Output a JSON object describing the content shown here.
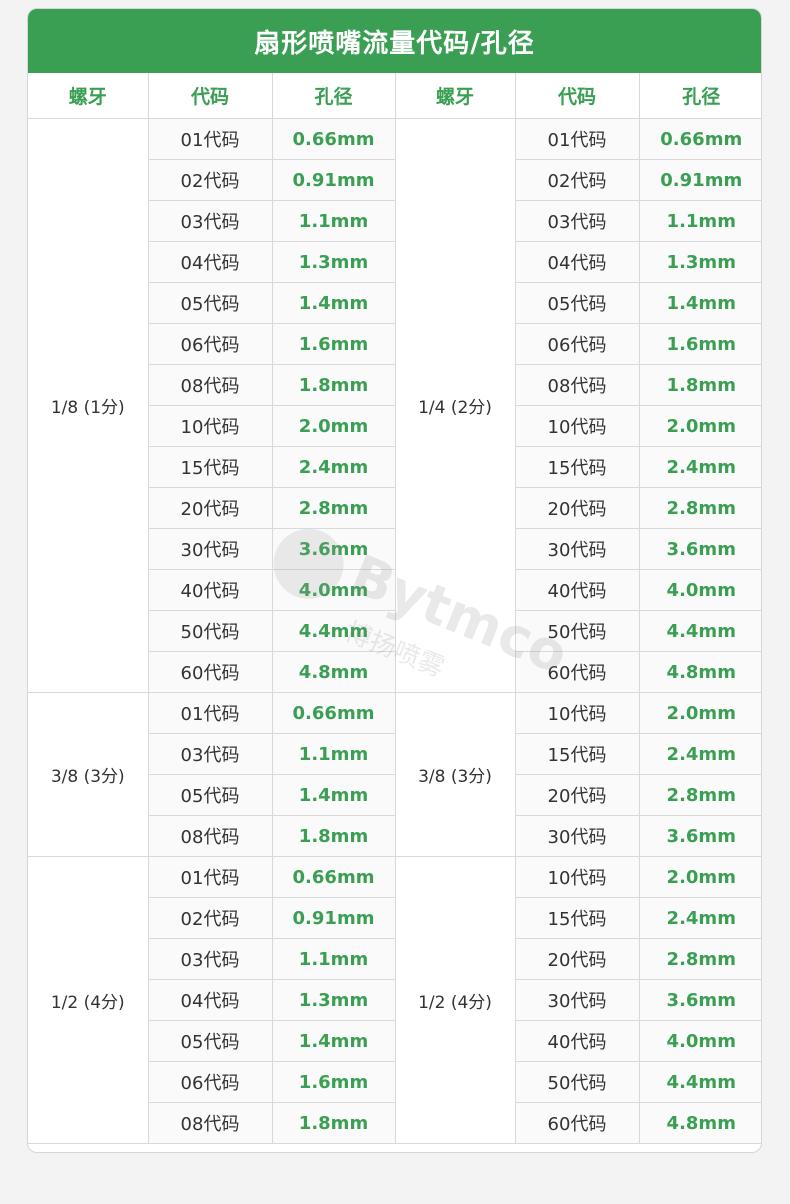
{
  "title": "扇形喷嘴流量代码/孔径",
  "headers": [
    "螺牙",
    "代码",
    "孔径",
    "螺牙",
    "代码",
    "孔径"
  ],
  "left_groups": [
    {
      "thread": "1/8 (1分)",
      "rows": [
        {
          "code": "01代码",
          "dia": "0.66mm"
        },
        {
          "code": "02代码",
          "dia": "0.91mm"
        },
        {
          "code": "03代码",
          "dia": "1.1mm"
        },
        {
          "code": "04代码",
          "dia": "1.3mm"
        },
        {
          "code": "05代码",
          "dia": "1.4mm"
        },
        {
          "code": "06代码",
          "dia": "1.6mm"
        },
        {
          "code": "08代码",
          "dia": "1.8mm"
        },
        {
          "code": "10代码",
          "dia": "2.0mm"
        },
        {
          "code": "15代码",
          "dia": "2.4mm"
        },
        {
          "code": "20代码",
          "dia": "2.8mm"
        },
        {
          "code": "30代码",
          "dia": "3.6mm"
        },
        {
          "code": "40代码",
          "dia": "4.0mm"
        },
        {
          "code": "50代码",
          "dia": "4.4mm"
        },
        {
          "code": "60代码",
          "dia": "4.8mm"
        }
      ]
    },
    {
      "thread": "3/8 (3分)",
      "rows": [
        {
          "code": "01代码",
          "dia": "0.66mm"
        },
        {
          "code": "03代码",
          "dia": "1.1mm"
        },
        {
          "code": "05代码",
          "dia": "1.4mm"
        },
        {
          "code": "08代码",
          "dia": "1.8mm"
        }
      ]
    },
    {
      "thread": "1/2 (4分)",
      "rows": [
        {
          "code": "01代码",
          "dia": "0.66mm"
        },
        {
          "code": "02代码",
          "dia": "0.91mm"
        },
        {
          "code": "03代码",
          "dia": "1.1mm"
        },
        {
          "code": "04代码",
          "dia": "1.3mm"
        },
        {
          "code": "05代码",
          "dia": "1.4mm"
        },
        {
          "code": "06代码",
          "dia": "1.6mm"
        },
        {
          "code": "08代码",
          "dia": "1.8mm"
        }
      ]
    }
  ],
  "right_groups": [
    {
      "thread": "1/4 (2分)",
      "rows": [
        {
          "code": "01代码",
          "dia": "0.66mm"
        },
        {
          "code": "02代码",
          "dia": "0.91mm"
        },
        {
          "code": "03代码",
          "dia": "1.1mm"
        },
        {
          "code": "04代码",
          "dia": "1.3mm"
        },
        {
          "code": "05代码",
          "dia": "1.4mm"
        },
        {
          "code": "06代码",
          "dia": "1.6mm"
        },
        {
          "code": "08代码",
          "dia": "1.8mm"
        },
        {
          "code": "10代码",
          "dia": "2.0mm"
        },
        {
          "code": "15代码",
          "dia": "2.4mm"
        },
        {
          "code": "20代码",
          "dia": "2.8mm"
        },
        {
          "code": "30代码",
          "dia": "3.6mm"
        },
        {
          "code": "40代码",
          "dia": "4.0mm"
        },
        {
          "code": "50代码",
          "dia": "4.4mm"
        },
        {
          "code": "60代码",
          "dia": "4.8mm"
        }
      ]
    },
    {
      "thread": "3/8 (3分)",
      "rows": [
        {
          "code": "10代码",
          "dia": "2.0mm"
        },
        {
          "code": "15代码",
          "dia": "2.4mm"
        },
        {
          "code": "20代码",
          "dia": "2.8mm"
        },
        {
          "code": "30代码",
          "dia": "3.6mm"
        }
      ]
    },
    {
      "thread": "1/2 (4分)",
      "rows": [
        {
          "code": "10代码",
          "dia": "2.0mm"
        },
        {
          "code": "15代码",
          "dia": "2.4mm"
        },
        {
          "code": "20代码",
          "dia": "2.8mm"
        },
        {
          "code": "30代码",
          "dia": "3.6mm"
        },
        {
          "code": "40代码",
          "dia": "4.0mm"
        },
        {
          "code": "50代码",
          "dia": "4.4mm"
        },
        {
          "code": "60代码",
          "dia": "4.8mm"
        }
      ]
    }
  ],
  "watermark": {
    "brand": "Bytmco",
    "brand_cn": "博扬喷雾"
  },
  "colors": {
    "accent": "#3a9f53",
    "text": "#333333",
    "border": "#d9d9d9"
  }
}
